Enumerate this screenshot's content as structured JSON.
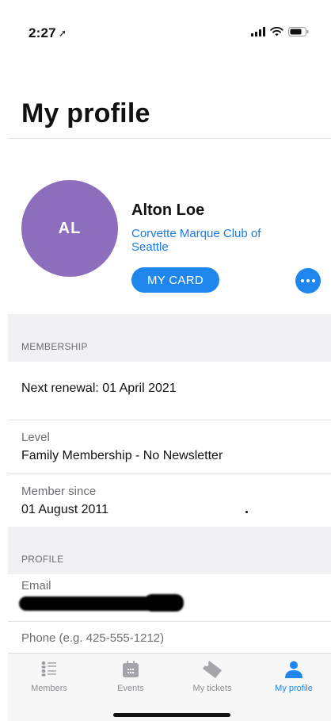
{
  "status": {
    "time": "2:27"
  },
  "header": {
    "title": "My profile"
  },
  "profile": {
    "initials": "AL",
    "name": "Alton Loe",
    "organization": "Corvette Marque Club of Seattle",
    "card_button": "MY CARD",
    "avatar_color": "#8d6ebd"
  },
  "membership": {
    "section_title": "MEMBERSHIP",
    "next_renewal": "Next renewal: 01 April 2021",
    "level_label": "Level",
    "level_value": "Family Membership - No Newsletter",
    "since_label": "Member since",
    "since_value": "01 August 2011"
  },
  "profile_section": {
    "section_title": "PROFILE",
    "email_label": "Email",
    "phone_label": "Phone (e.g. 425-555-1212)"
  },
  "tabs": [
    {
      "label": "Members",
      "icon": "members-icon",
      "active": false
    },
    {
      "label": "Events",
      "icon": "calendar-icon",
      "active": false
    },
    {
      "label": "My tickets",
      "icon": "ticket-icon",
      "active": false
    },
    {
      "label": "My profile",
      "icon": "person-icon",
      "active": true
    }
  ],
  "colors": {
    "accent": "#1f86ee",
    "link": "#1a7ae6",
    "inactive": "#8e8e93",
    "section_bg": "#f1f1f4"
  }
}
